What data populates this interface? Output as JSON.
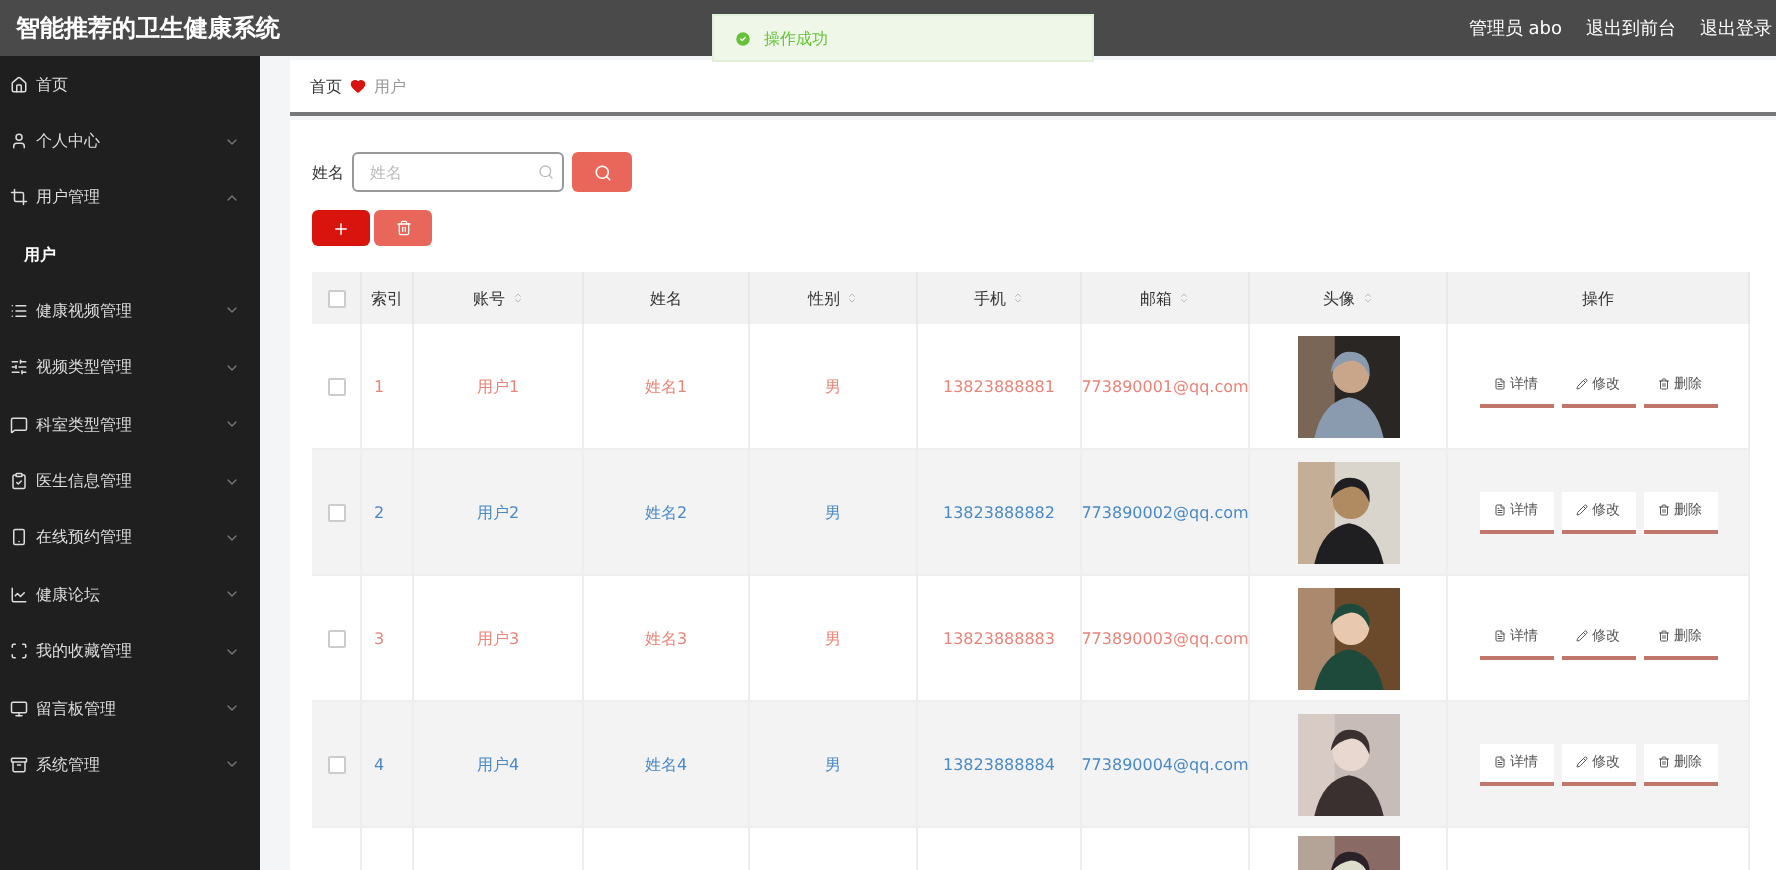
{
  "header": {
    "title": "智能推荐的卫生健康系统",
    "user": "管理员 abo",
    "links": [
      "退出到前台",
      "退出登录"
    ]
  },
  "toast": {
    "message": "操作成功"
  },
  "sidebar": {
    "items": [
      {
        "label": "首页",
        "kind": "link"
      },
      {
        "label": "个人中心",
        "kind": "menu",
        "expanded": false
      },
      {
        "label": "用户管理",
        "kind": "menu",
        "expanded": true,
        "children": [
          {
            "label": "用户",
            "selected": true
          }
        ]
      },
      {
        "label": "健康视频管理",
        "kind": "menu",
        "expanded": false
      },
      {
        "label": "视频类型管理",
        "kind": "menu",
        "expanded": false
      },
      {
        "label": "科室类型管理",
        "kind": "menu",
        "expanded": false
      },
      {
        "label": "医生信息管理",
        "kind": "menu",
        "expanded": false
      },
      {
        "label": "在线预约管理",
        "kind": "menu",
        "expanded": false
      },
      {
        "label": "健康论坛",
        "kind": "menu",
        "expanded": false
      },
      {
        "label": "我的收藏管理",
        "kind": "menu",
        "expanded": false
      },
      {
        "label": "留言板管理",
        "kind": "menu",
        "expanded": false
      },
      {
        "label": "系统管理",
        "kind": "menu",
        "expanded": false
      }
    ]
  },
  "breadcrumb": [
    "首页",
    "用户"
  ],
  "search": {
    "label": "姓名",
    "placeholder": "姓名"
  },
  "table": {
    "columns": [
      {
        "kind": "checkbox",
        "checked": false
      },
      {
        "kind": "text",
        "label": "索引",
        "sortable": false
      },
      {
        "kind": "text",
        "label": "账号",
        "sortable": true
      },
      {
        "kind": "text",
        "label": "姓名",
        "sortable": false
      },
      {
        "kind": "text",
        "label": "性别",
        "sortable": true
      },
      {
        "kind": "text",
        "label": "手机",
        "sortable": true
      },
      {
        "kind": "text",
        "label": "邮箱",
        "sortable": true
      },
      {
        "kind": "text",
        "label": "头像",
        "sortable": true
      },
      {
        "kind": "text",
        "label": "操作",
        "sortable": false
      }
    ],
    "rows": [
      {
        "kind": "full",
        "checked": false,
        "color": "#e8857a",
        "index": "1",
        "account": "用户1",
        "name": "姓名1",
        "gender": "男",
        "phone": "13823888881",
        "email": "773890001@qq.com",
        "actions": [
          "详情",
          "修改",
          "删除"
        ]
      },
      {
        "kind": "full",
        "checked": false,
        "color": "#4a8ac4",
        "index": "2",
        "account": "用户2",
        "name": "姓名2",
        "gender": "男",
        "phone": "13823888882",
        "email": "773890002@qq.com",
        "actions": [
          "详情",
          "修改",
          "删除"
        ]
      },
      {
        "kind": "full",
        "checked": false,
        "color": "#e8857a",
        "index": "3",
        "account": "用户3",
        "name": "姓名3",
        "gender": "男",
        "phone": "13823888883",
        "email": "773890003@qq.com",
        "actions": [
          "详情",
          "修改",
          "删除"
        ]
      },
      {
        "kind": "full",
        "checked": false,
        "color": "#4a8ac4",
        "index": "4",
        "account": "用户4",
        "name": "姓名4",
        "gender": "男",
        "phone": "13823888884",
        "email": "773890004@qq.com",
        "actions": [
          "详情",
          "修改",
          "删除"
        ]
      },
      {
        "kind": "cut"
      }
    ]
  }
}
